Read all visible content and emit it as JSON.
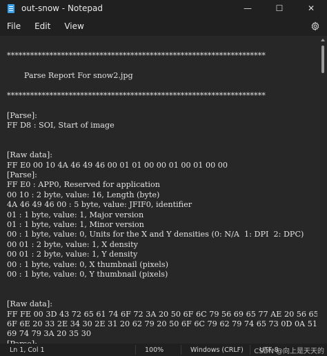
{
  "window": {
    "title": "out-snow - Notepad",
    "minimize": "—",
    "maximize": "☐",
    "close": "✕"
  },
  "menu": {
    "file": "File",
    "edit": "Edit",
    "view": "View",
    "settings_icon": "gear-icon"
  },
  "editor": {
    "lines": [
      "",
      "*******************************************************************",
      "",
      "       Parse Report For snow2.jpg",
      "",
      "*******************************************************************",
      "",
      "[Parse]:",
      "FF D8 : SOI, Start of image",
      "",
      "",
      "[Raw data]:",
      "FF E0 00 10 4A 46 49 46 00 01 01 00 00 01 00 01 00 00",
      "[Parse]:",
      "FF E0 : APP0, Reserved for application",
      "00 10 : 2 byte, value: 16, Length (byte)",
      "4A 46 49 46 00 : 5 byte, value: JFIF0, identifier",
      "01 : 1 byte, value: 1, Major version",
      "01 : 1 byte, value: 1, Minor version",
      "00 : 1 byte, value: 0, Units for the X and Y densities (0: N/A  1: DPI  2: DPC)",
      "00 01 : 2 byte, value: 1, X density",
      "00 01 : 2 byte, value: 1, Y density",
      "00 : 1 byte, value: 0, X thumbnail (pixels)",
      "00 : 1 byte, value: 0, Y thumbnail (pixels)",
      "",
      "",
      "[Raw data]:",
      "FF FE 00 3D 43 72 65 61 74 6F 72 3A 20 50 6F 6C 79 56 69 65 77 AE 20 56 65 72 73 69",
      "6F 6E 20 33 2E 34 30 2E 31 20 62 79 20 50 6F 6C 79 62 79 74 65 73 0D 0A 51 75 61 6C",
      "69 74 79 3A 20 35 30",
      "[Parse]:"
    ]
  },
  "status": {
    "position": "Ln 1, Col 1",
    "zoom": "100%",
    "line_ending": "Windows (CRLF)",
    "encoding": "UTF-8"
  },
  "watermark": "CSDN @向上是天天的"
}
